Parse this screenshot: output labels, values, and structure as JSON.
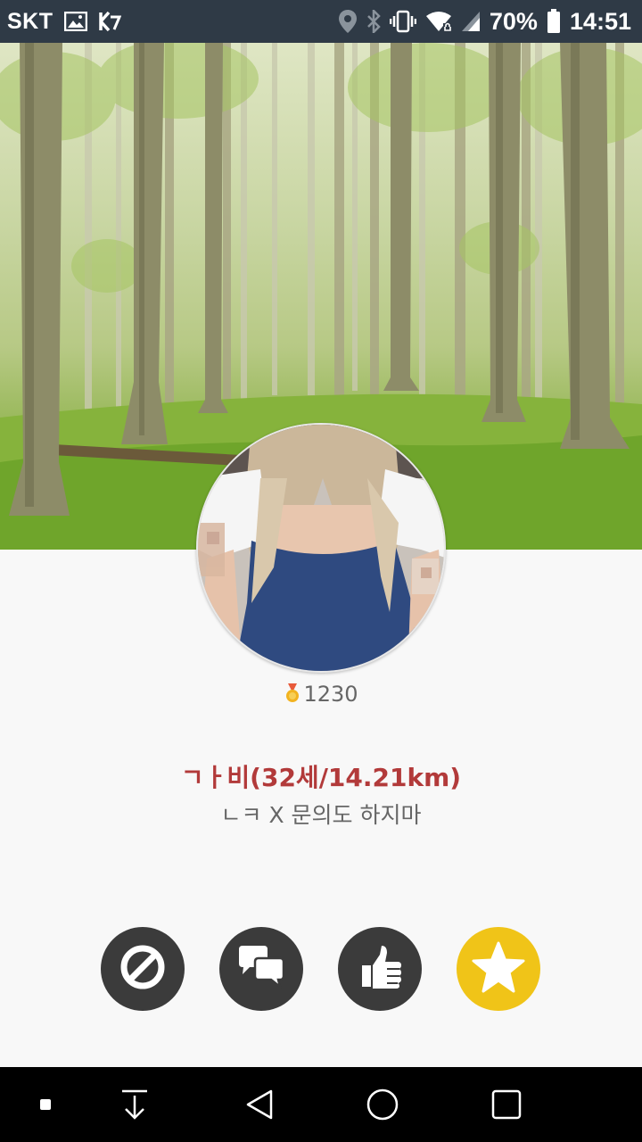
{
  "status_bar": {
    "carrier": "SKT",
    "battery": "70%",
    "time": "14:51",
    "left_icons": [
      "image-icon",
      "app-notification-icon"
    ],
    "right_icons": [
      "location-icon",
      "bluetooth-icon",
      "vibrate-icon",
      "wifi-icon",
      "signal-icon",
      "battery-icon"
    ]
  },
  "profile": {
    "points": "1230",
    "name_line": "ㄱㅏ비(32세/14.21km)",
    "status_message": "ㄴㅋ X 문의도 하지마"
  },
  "actions": [
    {
      "icon": "block-icon",
      "color": "#3b3b3b"
    },
    {
      "icon": "chat-icon",
      "color": "#3b3b3b"
    },
    {
      "icon": "thumbs-up-icon",
      "color": "#3b3b3b"
    },
    {
      "icon": "star-icon",
      "color": "#f0c418"
    }
  ],
  "nav_bar": {
    "items": [
      "square-dot-icon",
      "download-icon",
      "back-icon",
      "home-icon",
      "recents-icon"
    ]
  },
  "colors": {
    "status_bar_bg": "#2f3a46",
    "name_text": "#b23a3a",
    "muted_text": "#666666",
    "button_dark": "#3b3b3b",
    "button_star": "#f0c418"
  }
}
